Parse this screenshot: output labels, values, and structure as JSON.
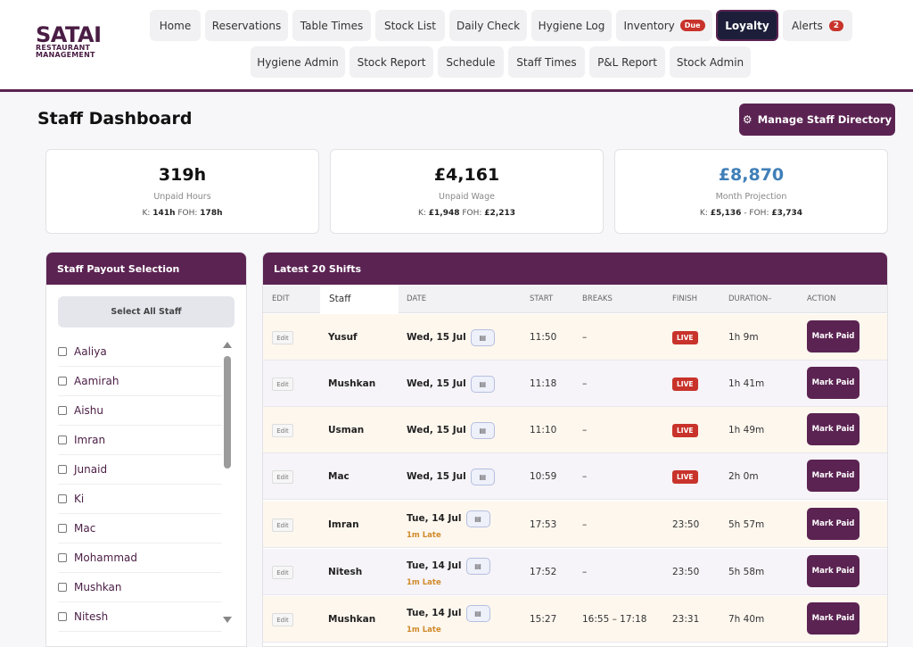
{
  "brand": {
    "main": "SATAI",
    "sub1": "RESTAURANT",
    "sub2": "MANAGEMENT"
  },
  "nav": {
    "row1": [
      {
        "label": "Home"
      },
      {
        "label": "Reservations"
      },
      {
        "label": "Table Times"
      },
      {
        "label": "Stock List"
      },
      {
        "label": "Daily Check"
      },
      {
        "label": "Hygiene Log"
      },
      {
        "label": "Inventory",
        "badge": "Due"
      },
      {
        "label": "Loyalty",
        "active": true
      },
      {
        "label": "Alerts",
        "badge": "2"
      }
    ],
    "row2": [
      {
        "label": "Hygiene Admin"
      },
      {
        "label": "Stock Report"
      },
      {
        "label": "Schedule"
      },
      {
        "label": "Staff Times"
      },
      {
        "label": "P&L Report"
      },
      {
        "label": "Stock Admin"
      }
    ]
  },
  "page": {
    "title": "Staff Dashboard",
    "manage_label": "Manage Staff Directory"
  },
  "stats": [
    {
      "value": "319h",
      "label": "Unpaid Hours",
      "k_label": "K: ",
      "k": "141h",
      "f_label": " FOH: ",
      "f": "178h"
    },
    {
      "value": "£4,161",
      "label": "Unpaid Wage",
      "k_label": "K: ",
      "k": "£1,948",
      "f_label": " FOH: ",
      "f": "£2,213"
    },
    {
      "value": "£8,870",
      "label": "Month Projection",
      "k_label": "K: ",
      "k": "£5,136",
      "f_label": " - FOH: ",
      "f": "£3,734"
    }
  ],
  "payout": {
    "title": "Staff Payout Selection",
    "select_all": "Select All Staff",
    "staff": [
      "Aaliya",
      "Aamirah",
      "Aishu",
      "Imran",
      "Junaid",
      "Ki",
      "Mac",
      "Mohammad",
      "Mushkan",
      "Nitesh"
    ]
  },
  "shifts": {
    "title": "Latest 20 Shifts",
    "headers": {
      "edit": "EDIT",
      "staff": "Staff",
      "date": "DATE",
      "start": "START",
      "breaks": "BREAKS",
      "finish": "FINISH",
      "duration": "DURATION–",
      "action": "ACTION"
    },
    "edit_label": "Edit",
    "live_label": "LIVE",
    "action_label": "Mark Paid",
    "rows": [
      {
        "staff": "Yusuf",
        "date": "Wed, 15 Jul",
        "late": "",
        "start": "11:50",
        "breaks": "–",
        "finish": "LIVE",
        "duration": "1h 9m"
      },
      {
        "staff": "Mushkan",
        "date": "Wed, 15 Jul",
        "late": "",
        "start": "11:18",
        "breaks": "–",
        "finish": "LIVE",
        "duration": "1h 41m"
      },
      {
        "staff": "Usman",
        "date": "Wed, 15 Jul",
        "late": "",
        "start": "11:10",
        "breaks": "–",
        "finish": "LIVE",
        "duration": "1h 49m"
      },
      {
        "staff": "Mac",
        "date": "Wed, 15 Jul",
        "late": "",
        "start": "10:59",
        "breaks": "–",
        "finish": "LIVE",
        "duration": "2h 0m"
      },
      {
        "staff": "Imran",
        "date": "Tue, 14 Jul",
        "late": "1m Late",
        "start": "17:53",
        "breaks": "–",
        "finish": "23:50",
        "duration": "5h 57m"
      },
      {
        "staff": "Nitesh",
        "date": "Tue, 14 Jul",
        "late": "1m Late",
        "start": "17:52",
        "breaks": "–",
        "finish": "23:50",
        "duration": "5h 58m"
      },
      {
        "staff": "Mushkan",
        "date": "Tue, 14 Jul",
        "late": "1m Late",
        "start": "15:27",
        "breaks": "16:55 – 17:18",
        "finish": "23:31",
        "duration": "7h 40m"
      }
    ]
  },
  "colors": {
    "brand": "#5b2352",
    "active_nav": "#1d1f3a",
    "live": "#c8332b",
    "projection": "#3f7fb8",
    "late": "#d08a2a"
  }
}
